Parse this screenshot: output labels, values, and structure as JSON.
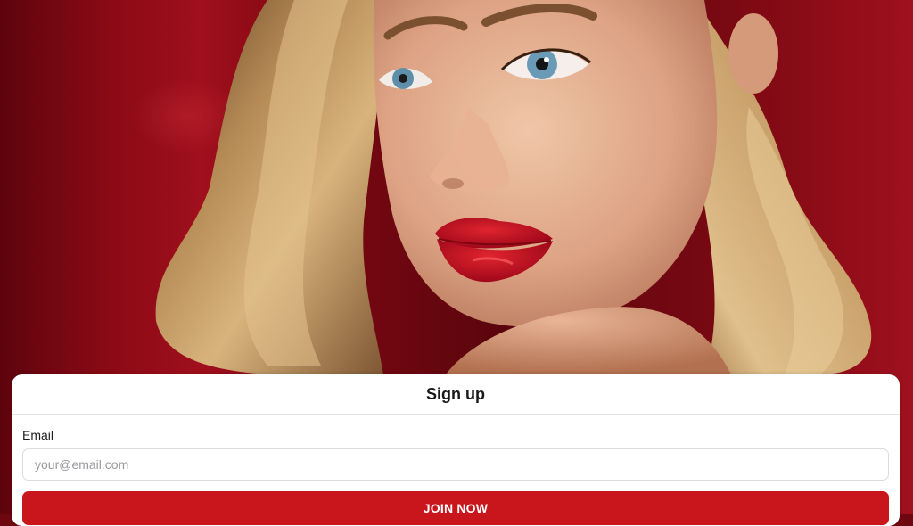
{
  "hero": {
    "image_alt": "Portrait photo of a model with wavy blonde hair and red lipstick on a red background"
  },
  "signup_card": {
    "title": "Sign up",
    "email_label": "Email",
    "email_value": "",
    "email_placeholder": "your@email.com",
    "submit_label": "JOIN NOW"
  },
  "colors": {
    "accent": "#c9161d",
    "background": "#8a0a16",
    "card": "#ffffff"
  }
}
